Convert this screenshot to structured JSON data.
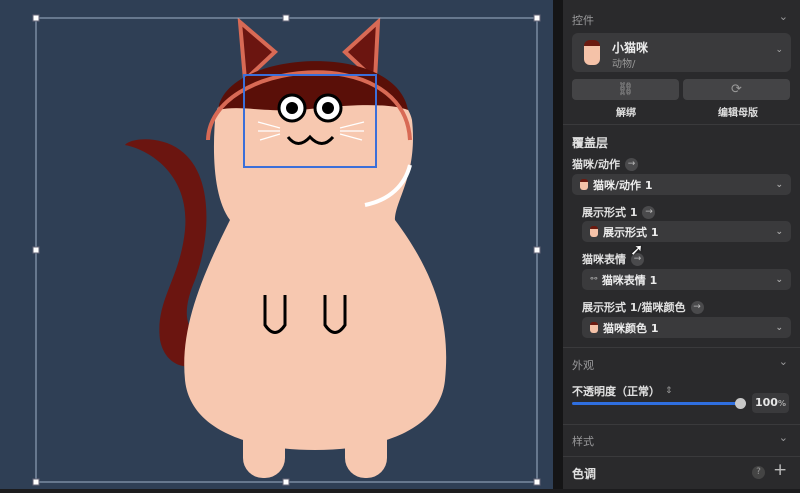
{
  "canvas": {
    "background": "#2f3f55",
    "selection_color": "#3b6fd9"
  },
  "panel": {
    "component": {
      "section": "控件",
      "name": "小猫咪",
      "path": "动物/",
      "detach_label": "解绑",
      "edit_master_label": "编辑母版"
    },
    "overrides": {
      "section": "覆盖层",
      "items": [
        {
          "label": "猫咪/动作",
          "value": "猫咪/动作 1"
        },
        {
          "label": "展示形式 1",
          "value": "展示形式 1"
        },
        {
          "label": "猫咪表情",
          "value": "猫咪表情 1"
        },
        {
          "label": "展示形式 1/猫咪颜色",
          "value": "猫咪颜色 1"
        }
      ]
    },
    "appearance": {
      "section": "外观",
      "opacity_label": "不透明度（正常）",
      "opacity_value": "100",
      "opacity_unit": "%",
      "opacity_fraction": 1.0,
      "accent": "#2f6fe0"
    },
    "style": {
      "section": "样式"
    },
    "tint": {
      "section": "色调",
      "help": "?",
      "add": "+"
    }
  }
}
